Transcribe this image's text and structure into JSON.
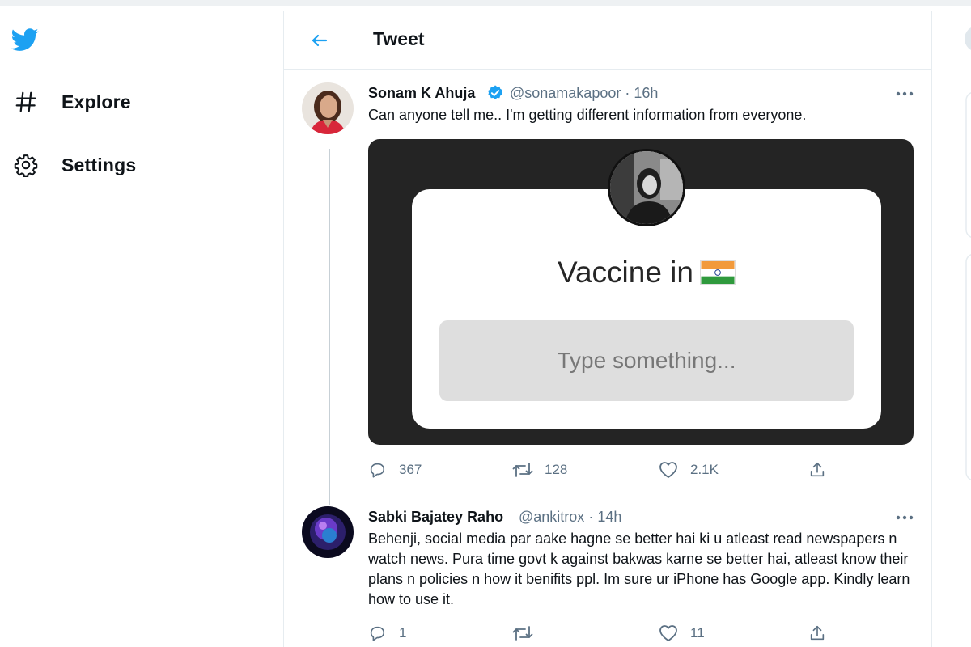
{
  "app": {
    "name": "Twitter",
    "brand_color": "#1da1f2"
  },
  "nav": {
    "items": [
      {
        "label": "Explore",
        "icon": "hashtag-icon"
      },
      {
        "label": "Settings",
        "icon": "gear-icon"
      }
    ]
  },
  "header": {
    "title": "Tweet"
  },
  "tweets": [
    {
      "author": "Sonam K Ahuja",
      "verified": true,
      "handle": "@sonamakapoor",
      "time": "16h",
      "text": "Can anyone tell me.. I'm getting different information from everyone.",
      "media": {
        "title": "Vaccine in",
        "flag_icon": "india-flag-icon",
        "input_placeholder": "Type something..."
      },
      "stats": {
        "replies": "367",
        "retweets": "128",
        "likes": "2.1K"
      }
    },
    {
      "author": "Sabki Bajatey Raho",
      "verified": false,
      "handle": "@ankitrox",
      "time": "14h",
      "text": "Behenji, social media par aake hagne se better hai ki u atleast read newspapers n watch news. Pura time govt k against bakwas karne se better hai, atleast know their plans n policies n how it benifits ppl. Im sure ur iPhone has Google app. Kindly learn how to use it.",
      "stats": {
        "replies": "1",
        "retweets": "",
        "likes": "11"
      }
    }
  ],
  "labels": {
    "separator": "·"
  }
}
